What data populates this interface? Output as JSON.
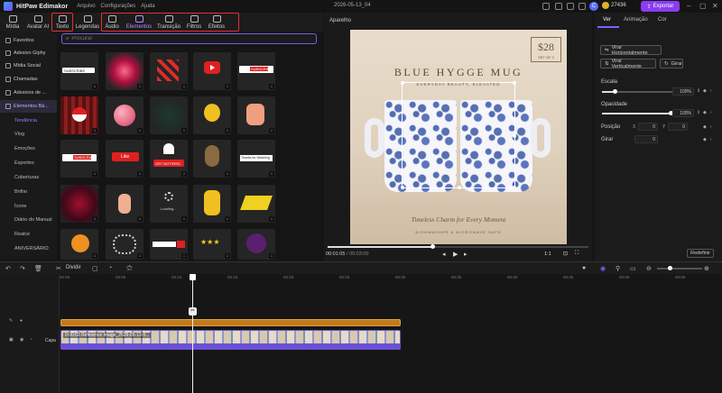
{
  "titlebar": {
    "app_name": "HitPaw Edimakor",
    "menus": [
      "Arquivo",
      "Configurações",
      "Ajuda"
    ],
    "document_name": "2026-05-13_04",
    "avatar_letter": "C",
    "credits": "27436",
    "export_label": "Exportar"
  },
  "categories": [
    {
      "label": "Mídia",
      "icon": "media-icon"
    },
    {
      "label": "Avatar AI",
      "icon": "avatar-icon"
    },
    {
      "label": "Texto",
      "icon": "text-icon"
    },
    {
      "label": "Legendas",
      "icon": "captions-icon"
    },
    {
      "label": "Áudio",
      "icon": "audio-icon"
    },
    {
      "label": "Elementos",
      "icon": "elements-icon"
    },
    {
      "label": "Transição",
      "icon": "transition-icon"
    },
    {
      "label": "Filtros",
      "icon": "filters-icon"
    },
    {
      "label": "Efeitos",
      "icon": "effects-icon"
    }
  ],
  "sidebar": {
    "items": [
      {
        "label": "Favoritos"
      },
      {
        "label": "Adesivo Giphy"
      },
      {
        "label": "Mídia Social"
      },
      {
        "label": "Chamadas"
      },
      {
        "label": "Adesivos de ..."
      },
      {
        "label": "Elementos Bá..."
      }
    ],
    "subitems": [
      "Tendência",
      "Vlog",
      "Emoções",
      "Esportes",
      "Coberturas",
      "Brilho",
      "Ícone",
      "Diário do Manual",
      "Realce",
      "ANIVERSÁRIO"
    ]
  },
  "search": {
    "placeholder": "Procurar"
  },
  "tiles": {
    "subscribe_1": "SUBSCRIBE",
    "subscribe_2": "SUBSCRIBE",
    "subscribe_3": "SUBSCRIBE",
    "like": "Like",
    "get_notified": "GET NOTIFIED",
    "loading": "Loading...",
    "thanks": "Thanks for Watching"
  },
  "preview": {
    "label": "Aparelho",
    "price": "$28",
    "price_sub": "SET OF 2",
    "title": "BLUE HYGGE MUG",
    "subtitle": "EVERYDAY BEAUTY, ELEVATED",
    "tagline": "Timeless Charm for Every Moment",
    "footer": "DISHWASHER & MICROWAVE SAFE",
    "time_current": "00:01:05",
    "time_total": "/ 00:03:00",
    "progress": 0.4,
    "ratio": "1:1"
  },
  "right_panel": {
    "tabs": [
      "Ver",
      "Animação",
      "Cor"
    ],
    "flip_h": "Virar Horizontalmente",
    "flip_v": "Virar Verticalmente",
    "rotate": "Girar",
    "scale_label": "Escala",
    "scale_value": "100%",
    "opacity_label": "Opacidade",
    "opacity_value": "100%",
    "position_label": "Posição",
    "pos_x_label": "X",
    "pos_x": "0",
    "pos_y_label": "Y",
    "pos_y": "0",
    "rotate_label": "Girar",
    "rotate_value": "0",
    "reset": "Redefinir"
  },
  "timeline": {
    "divide_label": "Dividir",
    "ruler": [
      "00:00",
      "00:05",
      "00:10",
      "00:15",
      "00:20",
      "00:25",
      "00:30",
      "00:35",
      "00:40",
      "00:45",
      "00:50",
      "00:55"
    ],
    "track_label": "Capa",
    "clip_name": "0:00:03 Reference Image_2026-05-13-0..."
  }
}
